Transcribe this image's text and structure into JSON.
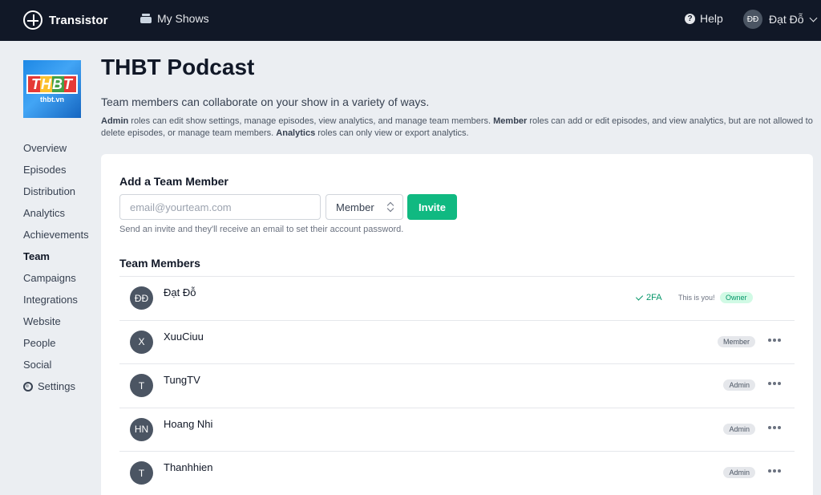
{
  "topbar": {
    "brand": "Transistor",
    "my_shows": "My Shows",
    "help": "Help",
    "user_initials": "ĐĐ",
    "user_name": "Đạt Đỗ"
  },
  "cover": {
    "logo_text": "THBT",
    "sub_text": "thbt.vn"
  },
  "sidebar": {
    "items": [
      {
        "label": "Overview"
      },
      {
        "label": "Episodes"
      },
      {
        "label": "Distribution"
      },
      {
        "label": "Analytics"
      },
      {
        "label": "Achievements"
      },
      {
        "label": "Team",
        "active": true
      },
      {
        "label": "Campaigns"
      },
      {
        "label": "Integrations"
      },
      {
        "label": "Website"
      },
      {
        "label": "People"
      },
      {
        "label": "Social"
      },
      {
        "label": "Settings",
        "icon": "gear-icon"
      }
    ]
  },
  "page": {
    "title": "THBT Podcast",
    "lead": "Team members can collaborate on your show in a variety of ways.",
    "desc_admin": "Admin",
    "desc_1": " roles can edit show settings, manage episodes, view analytics, and manage team members. ",
    "desc_member": "Member",
    "desc_2": " roles can add or edit episodes, and view analytics, but are not allowed to delete episodes, or manage team members. ",
    "desc_analytics": "Analytics",
    "desc_3": " roles can only view or export analytics."
  },
  "add_member": {
    "heading": "Add a Team Member",
    "email_placeholder": "email@yourteam.com",
    "role_value": "Member",
    "invite_label": "Invite",
    "hint": "Send an invite and they'll receive an email to set their account password."
  },
  "members": {
    "heading": "Team Members",
    "twofa": "2FA",
    "this_is_you": "This is you!",
    "list": [
      {
        "initials": "ĐĐ",
        "name": "Đạt Đỗ",
        "role": "Owner"
      },
      {
        "initials": "X",
        "name": "XuuCiuu",
        "role": "Member"
      },
      {
        "initials": "T",
        "name": "TungTV",
        "role": "Admin"
      },
      {
        "initials": "HN",
        "name": "Hoang Nhi",
        "role": "Admin"
      },
      {
        "initials": "T",
        "name": "Thanhhien",
        "role": "Admin"
      }
    ]
  },
  "colors": {
    "topbar": "#111827",
    "accent": "#10b981",
    "background": "#ebeef2"
  }
}
